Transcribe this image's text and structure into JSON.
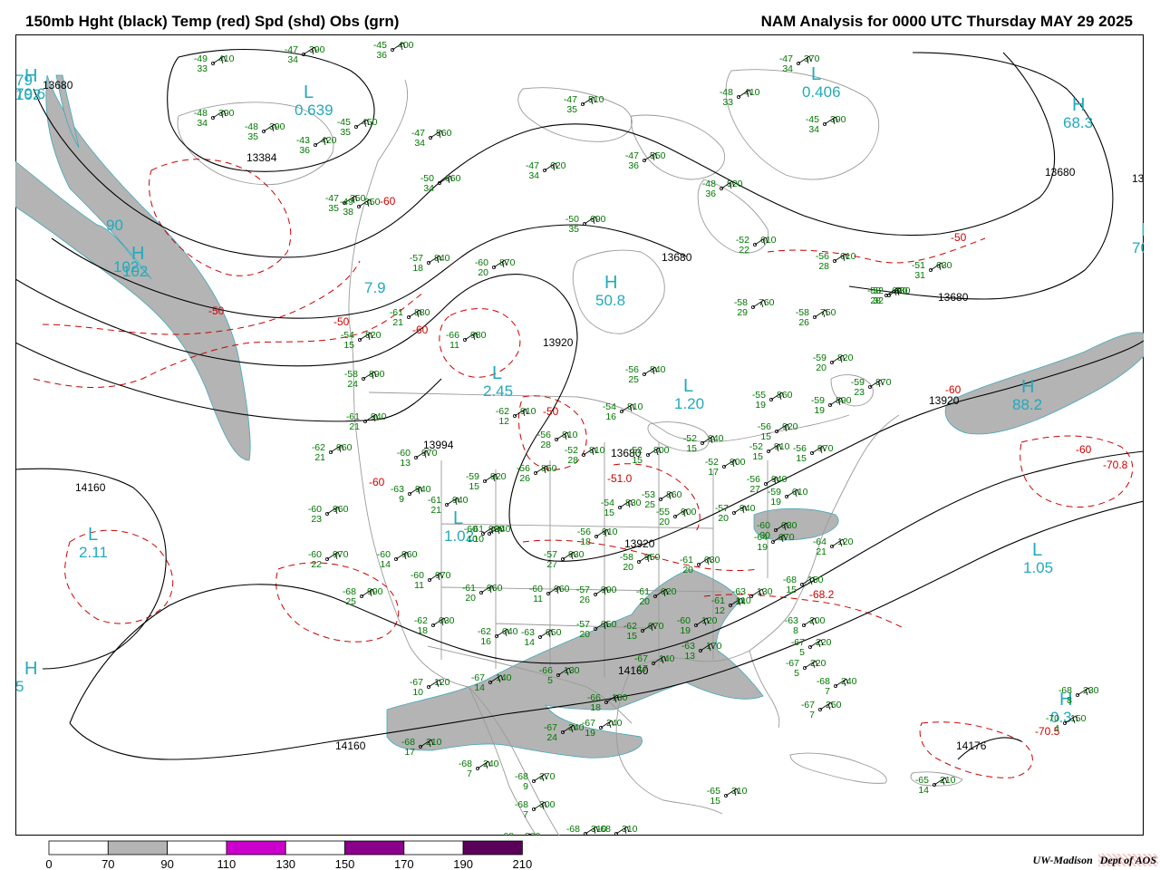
{
  "header": {
    "left_title": "150mb Hght (black) Temp (red) Spd (shd) Obs (grn)",
    "right_title": "NAM Analysis for 0000 UTC Thursday  MAY 29 2025"
  },
  "colors": {
    "height_contour": "#000000",
    "temperature_contour": "#cc0000",
    "observation": "#007700",
    "center_label": "#22aabb",
    "geography": "#9a9a9a",
    "speed_70_90": "#b4b4b4",
    "speed_110_130": "#cc00cc",
    "speed_150_170": "#8a008a",
    "speed_190_210": "#5a005a"
  },
  "legend": {
    "ticks": [
      "0",
      "70",
      "90",
      "110",
      "130",
      "150",
      "170",
      "190",
      "210"
    ],
    "segments": [
      {
        "from": "0",
        "to": "70",
        "color": "#ffffff"
      },
      {
        "from": "70",
        "to": "90",
        "color": "#b4b4b4"
      },
      {
        "from": "90",
        "to": "110",
        "color": "#ffffff"
      },
      {
        "from": "110",
        "to": "130",
        "color": "#cc00cc"
      },
      {
        "from": "130",
        "to": "150",
        "color": "#ffffff"
      },
      {
        "from": "150",
        "to": "170",
        "color": "#8a008a"
      },
      {
        "from": "170",
        "to": "190",
        "color": "#ffffff"
      },
      {
        "from": "190",
        "to": "210",
        "color": "#5a005a"
      }
    ]
  },
  "credit": {
    "org": "UW-Madison",
    "dept": "Dept of AOS"
  },
  "height_labels": [
    "13680",
    "13680",
    "13384",
    "13680",
    "13680",
    "13680",
    "13920",
    "13920",
    "13920",
    "14160",
    "14160",
    "14160",
    "14176",
    "13994",
    "13"
  ],
  "temperature_labels": [
    "-50",
    "-50",
    "-50",
    "-60",
    "-60",
    "-60",
    "-60",
    "-50",
    "-60",
    "-70.8",
    "-51.0",
    "-68.2",
    "-70.5"
  ],
  "centers": [
    {
      "letter": "L",
      "value": "0.639"
    },
    {
      "letter": "L",
      "value": "0.406"
    },
    {
      "letter": "H",
      "value": "68.3"
    },
    {
      "letter": "H",
      "value": "102"
    },
    {
      "letter": "H",
      "value": "70."
    },
    {
      "letter": "H",
      "value": "50.8"
    },
    {
      "letter": "L",
      "value": "2.45"
    },
    {
      "letter": "L",
      "value": "1.20"
    },
    {
      "letter": "H",
      "value": "88.2"
    },
    {
      "letter": "L",
      "value": "1.02"
    },
    {
      "letter": "L",
      "value": "2.11"
    },
    {
      "letter": "L",
      "value": "1.05"
    },
    {
      "letter": "H",
      "value": "79.6"
    },
    {
      "letter": "H",
      "value": "0.3"
    },
    {
      "letter": "H",
      "value": "5"
    }
  ],
  "speed_labels": [
    "90",
    "102",
    "7.9",
    "79",
    "102"
  ],
  "observations": [
    {
      "t": "-49",
      "d": "33",
      "h": "410"
    },
    {
      "t": "-47",
      "d": "34",
      "h": "390"
    },
    {
      "t": "-45",
      "d": "36",
      "h": "400"
    },
    {
      "t": "-48",
      "d": "34",
      "h": "390"
    },
    {
      "t": "-48",
      "d": "35",
      "h": "390"
    },
    {
      "t": "-43",
      "d": "36",
      "h": "420"
    },
    {
      "t": "-45",
      "d": "35",
      "h": "450"
    },
    {
      "t": "-47",
      "d": "34",
      "h": "560"
    },
    {
      "t": "-47",
      "d": "35",
      "h": "510"
    },
    {
      "t": "-47",
      "d": "34",
      "h": "370"
    },
    {
      "t": "-48",
      "d": "33",
      "h": "410"
    },
    {
      "t": "-45",
      "d": "34",
      "h": "390"
    },
    {
      "t": "-47",
      "d": "34",
      "h": "620"
    },
    {
      "t": "-47",
      "d": "36",
      "h": "550"
    },
    {
      "t": "-48",
      "d": "36",
      "h": "520"
    },
    {
      "t": "-50",
      "d": "34",
      "h": "660"
    },
    {
      "t": "-47",
      "d": "35",
      "h": "350"
    },
    {
      "t": "-49",
      "d": "38",
      "h": "350"
    },
    {
      "t": "-50",
      "d": "35",
      "h": "690"
    },
    {
      "t": "-52",
      "d": "22",
      "h": "610"
    },
    {
      "t": "-56",
      "d": "28",
      "h": "610"
    },
    {
      "t": "-51",
      "d": "31",
      "h": "630"
    },
    {
      "t": "-52",
      "d": "32",
      "h": "680"
    },
    {
      "t": "-57",
      "d": "18",
      "h": "840"
    },
    {
      "t": "-60",
      "d": "20",
      "h": "870"
    },
    {
      "t": "-58",
      "d": "28",
      "h": "670"
    },
    {
      "t": "-58",
      "d": "29",
      "h": "760"
    },
    {
      "t": "-58",
      "d": "26",
      "h": "750"
    },
    {
      "t": "-61",
      "d": "21",
      "h": "880"
    },
    {
      "t": "-54",
      "d": "15",
      "h": "820"
    },
    {
      "t": "-66",
      "d": "11",
      "h": "980"
    },
    {
      "t": "-56",
      "d": "25",
      "h": "840"
    },
    {
      "t": "-59",
      "d": "20",
      "h": "820"
    },
    {
      "t": "-59",
      "d": "23",
      "h": "870"
    },
    {
      "t": "-55",
      "d": "19",
      "h": "860"
    },
    {
      "t": "-59",
      "d": "19",
      "h": "890"
    },
    {
      "t": "-58",
      "d": "24",
      "h": "890"
    },
    {
      "t": "-54",
      "d": "16",
      "h": "810"
    },
    {
      "t": "-61",
      "d": "21",
      "h": "940"
    },
    {
      "t": "-62",
      "d": "12",
      "h": "910"
    },
    {
      "t": "-56",
      "d": "28",
      "h": "810"
    },
    {
      "t": "-52",
      "d": "28",
      "h": "810"
    },
    {
      "t": "-52",
      "d": "15",
      "h": "840"
    },
    {
      "t": "-56",
      "d": "15",
      "h": "920"
    },
    {
      "t": "-62",
      "d": "21",
      "h": "960"
    },
    {
      "t": "-60",
      "d": "13",
      "h": "970"
    },
    {
      "t": "-56",
      "d": "26",
      "h": "850"
    },
    {
      "t": "-52",
      "d": "15",
      "h": "800"
    },
    {
      "t": "-52",
      "d": "17",
      "h": "900"
    },
    {
      "t": "-52",
      "d": "15",
      "h": "910"
    },
    {
      "t": "-56",
      "d": "15",
      "h": "970"
    },
    {
      "t": "-59",
      "d": "15",
      "h": "920"
    },
    {
      "t": "-63",
      "d": "9",
      "h": "940"
    },
    {
      "t": "-61",
      "d": "21",
      "h": "940"
    },
    {
      "t": "-60",
      "d": "23",
      "h": "960"
    },
    {
      "t": "-61",
      "d": "10",
      "h": "940"
    },
    {
      "t": "-53",
      "d": "25",
      "h": "860"
    },
    {
      "t": "-56",
      "d": "27",
      "h": "940"
    },
    {
      "t": "-59",
      "d": "19",
      "h": "010"
    },
    {
      "t": "-54",
      "d": "15",
      "h": "830"
    },
    {
      "t": "-55",
      "d": "20",
      "h": "900"
    },
    {
      "t": "-57",
      "d": "20",
      "h": "940"
    },
    {
      "t": "-60",
      "d": "30",
      "h": "030"
    },
    {
      "t": "-64",
      "d": "19",
      "h": "070"
    },
    {
      "t": "-64",
      "d": "21",
      "h": "120"
    },
    {
      "t": "-60",
      "d": "10",
      "h": "930"
    },
    {
      "t": "-56",
      "d": "18",
      "h": "910"
    },
    {
      "t": "-57",
      "d": "27",
      "h": "930"
    },
    {
      "t": "-58",
      "d": "20",
      "h": "950"
    },
    {
      "t": "-61",
      "d": "20",
      "h": "030"
    },
    {
      "t": "-60",
      "d": "22",
      "h": "970"
    },
    {
      "t": "-60",
      "d": "14",
      "h": "960"
    },
    {
      "t": "-60",
      "d": "11",
      "h": "970"
    },
    {
      "t": "-68",
      "d": "25",
      "h": "990"
    },
    {
      "t": "-61",
      "d": "20",
      "h": "960"
    },
    {
      "t": "-60",
      "d": "11",
      "h": "960"
    },
    {
      "t": "-57",
      "d": "26",
      "h": "990"
    },
    {
      "t": "-61",
      "d": "20",
      "h": "020"
    },
    {
      "t": "-61",
      "d": "12",
      "h": "110"
    },
    {
      "t": "-63",
      "d": "14",
      "h": "130"
    },
    {
      "t": "-68",
      "d": "15",
      "h": "150"
    },
    {
      "t": "-62",
      "d": "18",
      "h": "030"
    },
    {
      "t": "-62",
      "d": "16",
      "h": "040"
    },
    {
      "t": "-63",
      "d": "14",
      "h": "050"
    },
    {
      "t": "-57",
      "d": "20",
      "h": "050"
    },
    {
      "t": "-62",
      "d": "15",
      "h": "070"
    },
    {
      "t": "-60",
      "d": "19",
      "h": "120"
    },
    {
      "t": "-63",
      "d": "13",
      "h": "170"
    },
    {
      "t": "-67",
      "d": "17",
      "h": "140"
    },
    {
      "t": "-63",
      "d": "8",
      "h": "200"
    },
    {
      "t": "-67",
      "d": "5",
      "h": "220"
    },
    {
      "t": "-67",
      "d": "5",
      "h": "220"
    },
    {
      "t": "-67",
      "d": "10",
      "h": "120"
    },
    {
      "t": "-67",
      "d": "14",
      "h": "140"
    },
    {
      "t": "-66",
      "d": "5",
      "h": "130"
    },
    {
      "t": "-66",
      "d": "18",
      "h": "180"
    },
    {
      "t": "-68",
      "d": "7",
      "h": "240"
    },
    {
      "t": "-67",
      "d": "7",
      "h": "250"
    },
    {
      "t": "-68",
      "d": "17",
      "h": "210"
    },
    {
      "t": "-67",
      "d": "24",
      "h": "240"
    },
    {
      "t": "-67",
      "d": "19",
      "h": "240"
    },
    {
      "t": "-68",
      "d": "7",
      "h": "240"
    },
    {
      "t": "-68",
      "d": "9",
      "h": "270"
    },
    {
      "t": "-68",
      "d": "7",
      "h": "300"
    },
    {
      "t": "-68",
      "d": "14",
      "h": "320"
    },
    {
      "t": "-68",
      "d": "21",
      "h": "310"
    },
    {
      "t": "-68",
      "d": "21",
      "h": "310"
    },
    {
      "t": "-65",
      "d": "15",
      "h": "310"
    },
    {
      "t": "-65",
      "d": "14",
      "h": "210"
    },
    {
      "t": "-70",
      "d": "4",
      "h": "150"
    },
    {
      "t": "-68",
      "d": "8",
      "h": "230"
    }
  ]
}
